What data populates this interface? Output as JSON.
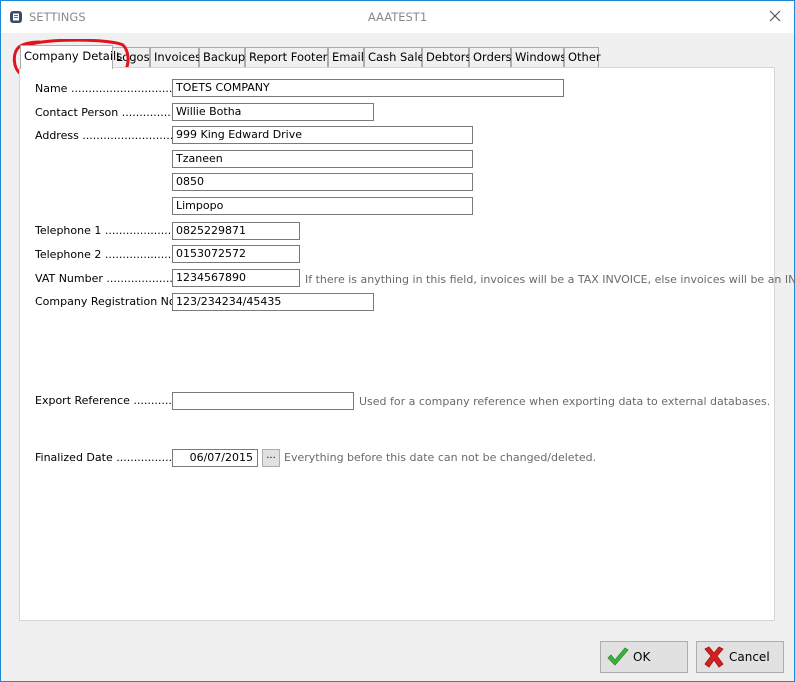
{
  "window": {
    "title_left": "SETTINGS",
    "title_center": "AAATEST1"
  },
  "tabs": [
    {
      "label": "Company Details",
      "active": true
    },
    {
      "label": "Logos"
    },
    {
      "label": "Invoices"
    },
    {
      "label": "Backup"
    },
    {
      "label": "Report Footers"
    },
    {
      "label": "Email"
    },
    {
      "label": "Cash Sale"
    },
    {
      "label": "Debtors"
    },
    {
      "label": "Orders"
    },
    {
      "label": "Windows"
    },
    {
      "label": "Other"
    }
  ],
  "form": {
    "name": {
      "label": "Name ..................................",
      "value": "TOETS COMPANY"
    },
    "contact": {
      "label": "Contact Person ....................",
      "value": "Willie Botha"
    },
    "address": {
      "label": "Address .................................",
      "lines": [
        "999 King Edward Drive",
        "Tzaneen",
        "0850",
        "Limpopo"
      ]
    },
    "tel1": {
      "label": "Telephone 1 .........................",
      "value": "0825229871"
    },
    "tel2": {
      "label": "Telephone 2 .........................",
      "value": "0153072572"
    },
    "vat": {
      "label": "VAT Number ........................",
      "value": "1234567890",
      "hint": "If there is anything in this field, invoices will be a TAX INVOICE, else invoices will be an INVOICE."
    },
    "reg": {
      "label": "Company Registration No ....",
      "value": "123/234234/45435"
    },
    "export": {
      "label": "Export Reference ................",
      "value": "",
      "hint": "Used for a company reference when exporting data to external databases."
    },
    "finalized": {
      "label": "Finalized Date .....................",
      "value": "06/07/2015",
      "button": "...",
      "hint": "Everything before this date can not be changed/deleted."
    }
  },
  "buttons": {
    "ok": "OK",
    "cancel": "Cancel"
  },
  "colors": {
    "window_border": "#1a8ad4",
    "annotation": "#e0141e",
    "ok_check": "#3cb43c",
    "cancel_x": "#d42020"
  }
}
